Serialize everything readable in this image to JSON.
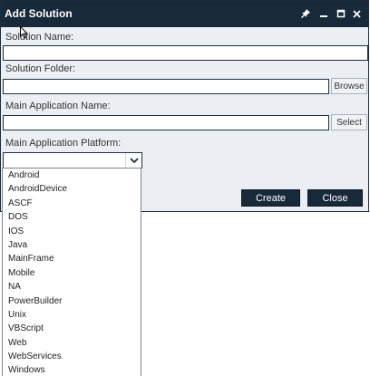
{
  "window": {
    "title": "Add Solution",
    "controls": [
      "pin-icon",
      "minimize-icon",
      "maximize-icon",
      "close-icon"
    ]
  },
  "form": {
    "solution_name_label": "Solution Name:",
    "solution_name_value": "",
    "solution_folder_label": "Solution Folder:",
    "solution_folder_value": "",
    "browse_label": "Browse",
    "main_app_name_label": "Main Application Name:",
    "main_app_name_value": "",
    "select_label": "Select",
    "platform_label": "Main Application Platform:",
    "platform_value": ""
  },
  "buttons": {
    "create": "Create",
    "close": "Close"
  },
  "platform_options": [
    "Android",
    "AndroidDevice",
    "ASCF",
    "DOS",
    "IOS",
    "Java",
    "MainFrame",
    "Mobile",
    "NA",
    "PowerBuilder",
    "Unix",
    "VBScript",
    "Web",
    "WebServices",
    "Windows"
  ],
  "colors": {
    "titlebar": "#18293a",
    "dialog_bg": "#ebeff3",
    "primary_button": "#18293a"
  }
}
